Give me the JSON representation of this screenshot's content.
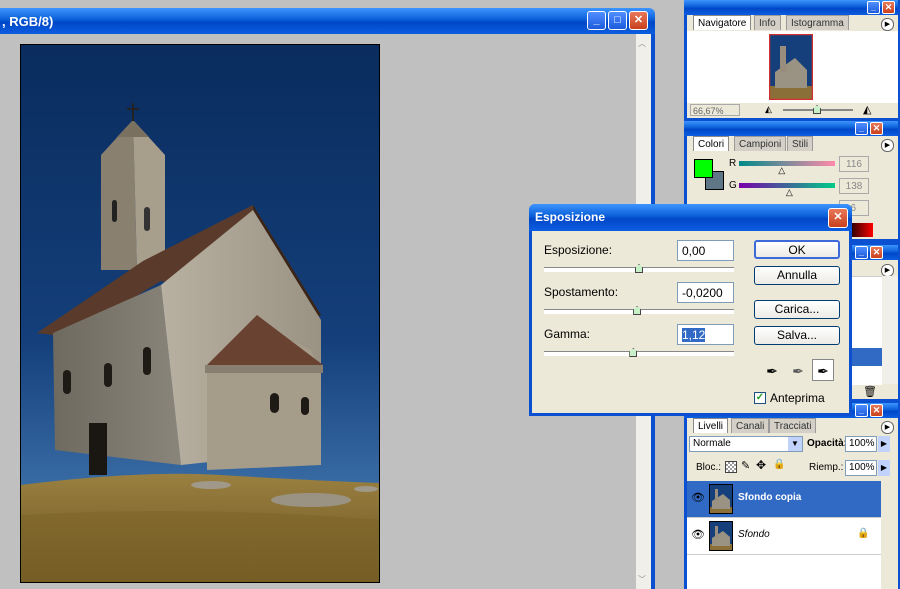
{
  "document": {
    "title_fragment": ", RGB/8)"
  },
  "navigator": {
    "tabs": [
      "Navigatore",
      "Info",
      "Istogramma"
    ],
    "zoom": "66,67%"
  },
  "colors": {
    "tabs": [
      "Colori",
      "Campioni",
      "Stili"
    ],
    "r_label": "R",
    "g_label": "G",
    "r_value": "116",
    "g_value": "138",
    "b_value_partial": "6",
    "r_position": 0.45,
    "g_position": 0.53
  },
  "dialog": {
    "title": "Esposizione",
    "exposure_label": "Esposizione:",
    "exposure_value": "0,00",
    "offset_label": "Spostamento:",
    "offset_value": "-0,0200",
    "gamma_label": "Gamma:",
    "gamma_value": "1,12",
    "exposure_slider": 0.5,
    "offset_slider": 0.49,
    "gamma_slider": 0.47,
    "ok_label": "OK",
    "cancel_label": "Annulla",
    "load_label": "Carica...",
    "save_label": "Salva...",
    "preview_label": "Anteprima",
    "preview_checked": true
  },
  "layers": {
    "tabs": [
      "Livelli",
      "Canali",
      "Tracciati"
    ],
    "blend_mode": "Normale",
    "opacity_label": "Opacità:",
    "opacity_value": "100%",
    "lock_label": "Bloc.:",
    "fill_label": "Riemp.:",
    "fill_value": "100%",
    "items": [
      {
        "name": "Sfondo copia",
        "selected": true
      },
      {
        "name": "Sfondo",
        "selected": false
      }
    ]
  },
  "colors_theme": {
    "selection": "#316ac5",
    "foreground_swatch": "#00ff00",
    "background_swatch": "#5f7687"
  }
}
